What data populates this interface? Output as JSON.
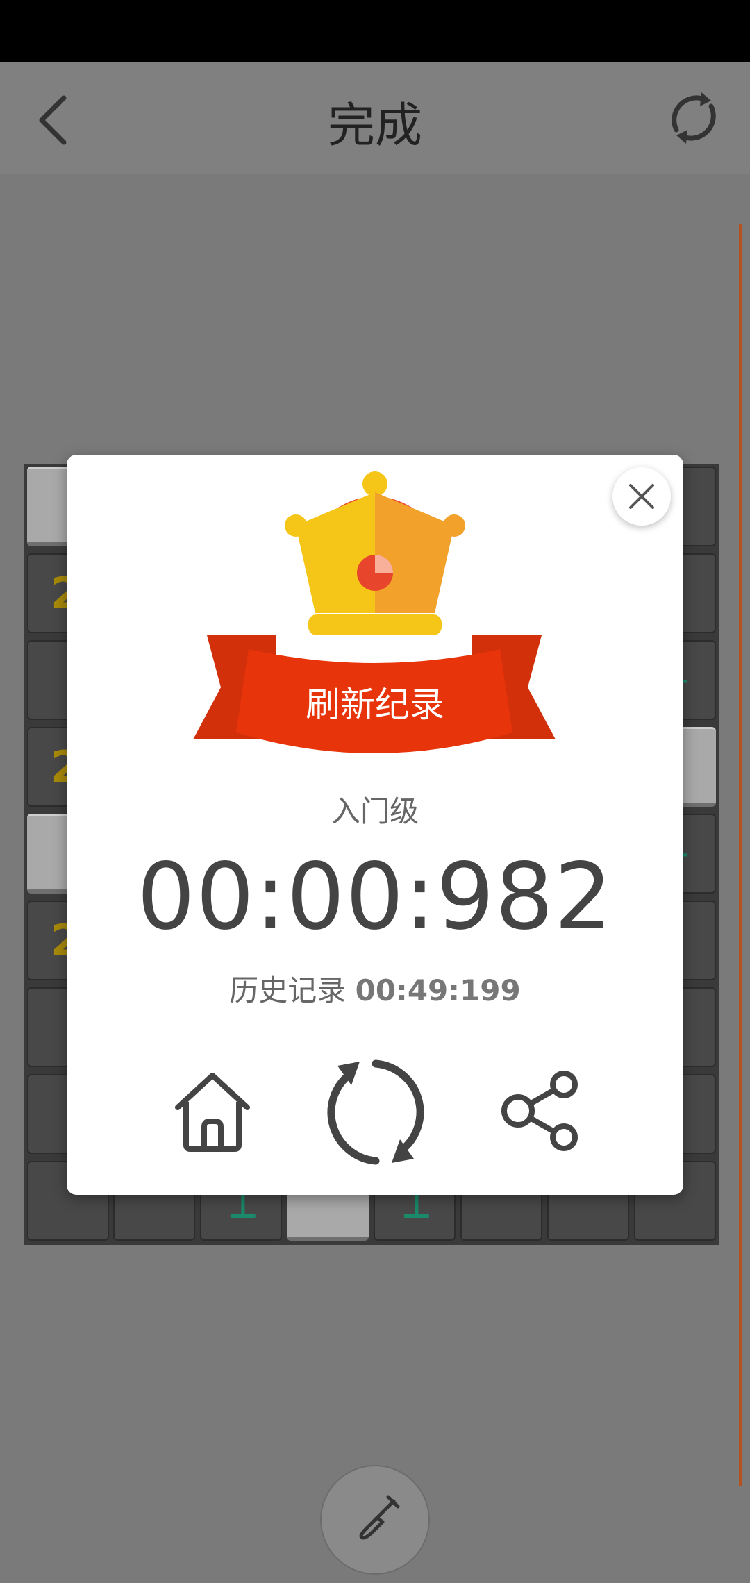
{
  "appbar": {
    "title": "完成"
  },
  "board": {
    "rows": [
      [
        "",
        "",
        "",
        "",
        "",
        "",
        "",
        ""
      ],
      [
        "2",
        "",
        "",
        "",
        "",
        "",
        "",
        ""
      ],
      [
        "",
        "",
        "",
        "",
        "",
        "",
        "",
        ""
      ],
      [
        "2",
        "",
        "",
        "",
        "",
        "",
        "",
        ""
      ],
      [
        "",
        "",
        "",
        "",
        "",
        "",
        "",
        ""
      ],
      [
        "2",
        "",
        "",
        "",
        "",
        "",
        "",
        ""
      ],
      [
        "",
        "",
        "",
        "",
        "",
        "",
        "",
        ""
      ],
      [
        "",
        "",
        "",
        "",
        "",
        "",
        "",
        ""
      ],
      [
        "",
        "",
        "",
        "",
        "",
        "",
        "",
        ""
      ]
    ]
  },
  "result": {
    "badge": "刷新纪录",
    "level": "入门级",
    "time": "00:00:982",
    "history_label": "历史记录",
    "history_value": "00:49:199"
  },
  "colors": {
    "overlay": "#7a7a7a",
    "ribbon": "#e8340b",
    "crown_gold": "#f5c518",
    "crown_orange": "#f2a12a",
    "crown_red": "#e8462c",
    "number": "#a88a0a",
    "flag": "#1a8a6a"
  },
  "icons": {
    "back": "chevron-left-icon",
    "refresh": "refresh-icon",
    "close": "close-icon",
    "home": "home-icon",
    "replay": "replay-icon",
    "share": "share-icon",
    "dig": "shovel-icon"
  }
}
